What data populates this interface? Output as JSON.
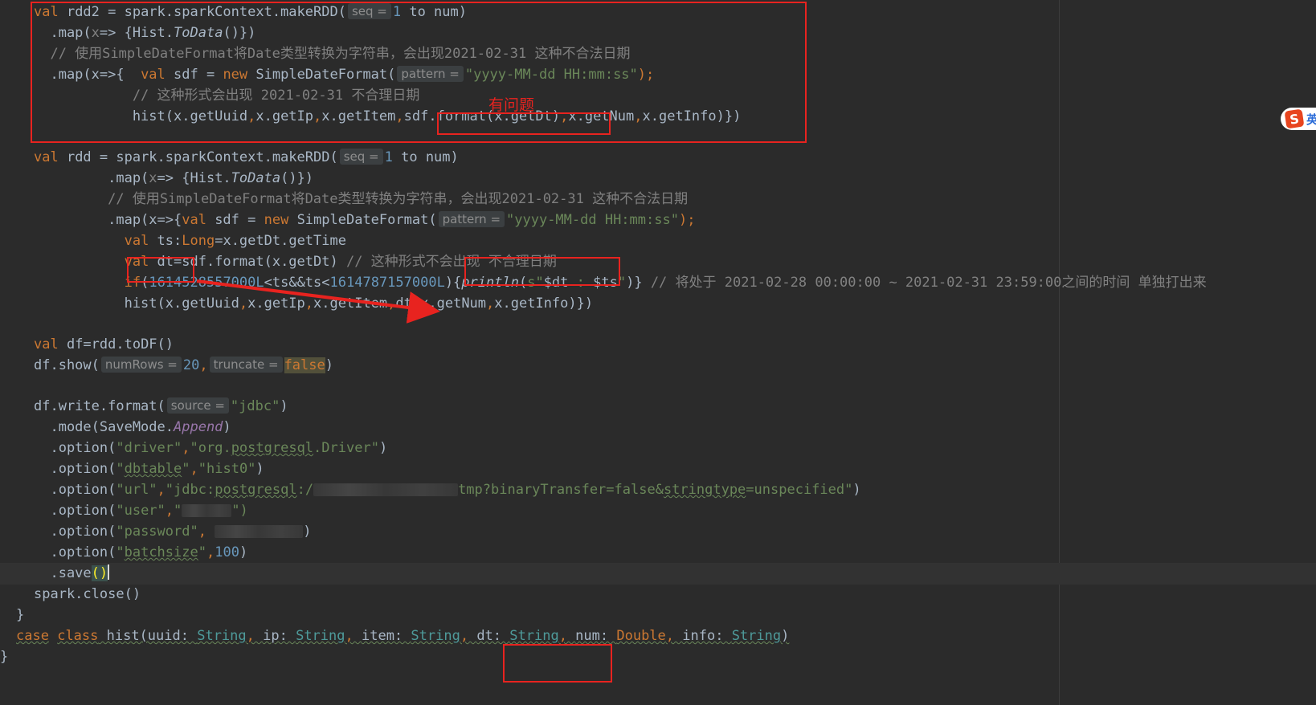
{
  "editor": {
    "line1": {
      "a": "val",
      "b": " rdd2 = spark.sparkContext.makeRDD(",
      "hint": "seq =",
      "c": "1",
      "d": " to num)"
    },
    "line2": {
      "a": "  .map(",
      "b": "x",
      "c": "=> {Hist.",
      "d": "ToData",
      "e": "()})"
    },
    "line3": {
      "a": "  // 使用SimpleDateFormat将Date类型转换为字符串，会出现2021-02-31 这种不合法日期"
    },
    "line4": {
      "a": "  .map(x=>{  ",
      "b": "val",
      "c": " sdf = ",
      "d": "new",
      "e": " SimpleDateFormat(",
      "hint": "pattern =",
      "f": "\"yyyy-MM-dd HH:mm:ss\"",
      "g": ");"
    },
    "line5": {
      "a": "            // 这种形式会出现 2021-02-31 不合理日期"
    },
    "line6": {
      "a": "            hist(x.getUuid",
      "b": ",",
      "c": "x.getIp",
      "d": ",",
      "e": "x.getItem",
      "f": ",",
      "g": "sdf.format(x.getDt)",
      "h": ",",
      "i": "x.getNum",
      "j": ",",
      "k": "x.getInfo)})"
    },
    "line8": {
      "a": "val",
      "b": " rdd = spark.sparkContext.makeRDD(",
      "hint": "seq =",
      "c": "1",
      "d": " to num)"
    },
    "line9": {
      "a": "         .map(",
      "b": "x",
      "c": "=> {Hist.",
      "d": "ToData",
      "e": "()})"
    },
    "line10": {
      "a": "         // 使用SimpleDateFormat将Date类型转换为字符串，会出现2021-02-31 这种不合法日期"
    },
    "line11": {
      "a": "         .map(x=>{",
      "b": "val",
      "c": " sdf = ",
      "d": "new",
      "e": " SimpleDateFormat(",
      "hint": "pattern =",
      "f": "\"yyyy-MM-dd HH:mm:ss\"",
      "g": ");"
    },
    "line12": {
      "a": "           ",
      "b": "val",
      "c": " ts:",
      "d": "Long",
      "e": "=x.getDt.getTime"
    },
    "line13": {
      "a": "           ",
      "b": "val",
      "c": " dt=sdf.format(x.getDt) ",
      "d": "// 这种形式不会出现 不合理日期"
    },
    "line14": {
      "a": "           ",
      "b": "if",
      "c": "(",
      "d": "1614528557000L",
      "e": "<ts&&ts<",
      "f": "1614787157000L",
      "g": "){",
      "h": "println",
      "i": "(",
      "j": "s\"",
      "k": "$dt",
      "l": " : ",
      "m": "$ts",
      "n": "\"",
      "o": ")} ",
      "p": "// 将处于 2021-02-28 00:00:00 ~ 2021-02-31 23:59:00之间的时间 单独打出来"
    },
    "line15": {
      "a": "           hist(x.getUuid",
      "b": ",",
      "c": "x.getIp",
      "d": ",",
      "e": "x.getItem",
      "f": ",",
      "g": "dt",
      "h": ",",
      "i": "x.getNum",
      "j": ",",
      "k": "x.getInfo)})"
    },
    "line17": {
      "a": "val",
      "b": " df=rdd.toDF()"
    },
    "line18": {
      "a": "df.show(",
      "hint1": "numRows =",
      "b": "20",
      ",": ",",
      "hint2": "truncate =",
      "c": "false",
      "d": ")"
    },
    "line20": {
      "a": "df.write.format(",
      "hint": "source =",
      "b": "\"jdbc\"",
      "c": ")"
    },
    "line21": {
      "a": "  .mode(SaveMode.",
      "b": "Append",
      "c": ")"
    },
    "line22": {
      "a": "  .option(",
      "b": "\"driver\"",
      "c": ",",
      "d": "\"org.",
      "e": "postgresql",
      "f": ".Driver\"",
      "g": ")"
    },
    "line23": {
      "a": "  .option(",
      "b": "\"",
      "c": "dbtable",
      "d": "\"",
      "e": ",",
      "f": "\"hist0\"",
      "g": ")"
    },
    "line24": {
      "a": "  .option(",
      "b": "\"url\"",
      "c": ",",
      "d": "\"jdbc:",
      "e": "postgresql",
      "f": ":/",
      "g": "tmp?binaryTransfer=false&",
      "h": "stringtype",
      "i": "=unspecified\"",
      "j": ")"
    },
    "line25": {
      "a": "  .option(",
      "b": "\"user\"",
      "c": ",",
      "d": "\"",
      "e": "\")"
    },
    "line26": {
      "a": "  .option(",
      "b": "\"password\"",
      "c": ", ",
      "d": ")"
    },
    "line27": {
      "a": "  .option(",
      "b": "\"",
      "c": "batchsize",
      "d": "\"",
      "e": ",",
      "f": "100",
      "g": ")"
    },
    "line28": {
      "a": "  .save",
      "b": "()"
    },
    "line29": {
      "a": "spark.close()"
    },
    "line30": {
      "a": "}"
    },
    "line31": {
      "a": "case",
      "b": " ",
      "c": "class",
      "d": " hist(uuid: ",
      "e": "String",
      ",1": ", ",
      "f": "ip: ",
      "g": "String",
      ",2": ", ",
      "h": "item: ",
      "i": "String",
      ",3": ", ",
      "j": "dt: ",
      "k": "String",
      ",4": ", ",
      "l": "num: ",
      "m": "Double",
      ",5": ", ",
      "n": "info: ",
      "o": "String",
      "p": ")"
    },
    "line32": {
      "a": "}"
    }
  },
  "annotation_label": "有问题",
  "ime": {
    "badge": "S",
    "text": "英"
  },
  "colors": {
    "background": "#2b2b2b",
    "keyword": "#cc7832",
    "string": "#6a8759",
    "number": "#6897bb",
    "comment": "#808080",
    "annotation": "#e8231f"
  }
}
